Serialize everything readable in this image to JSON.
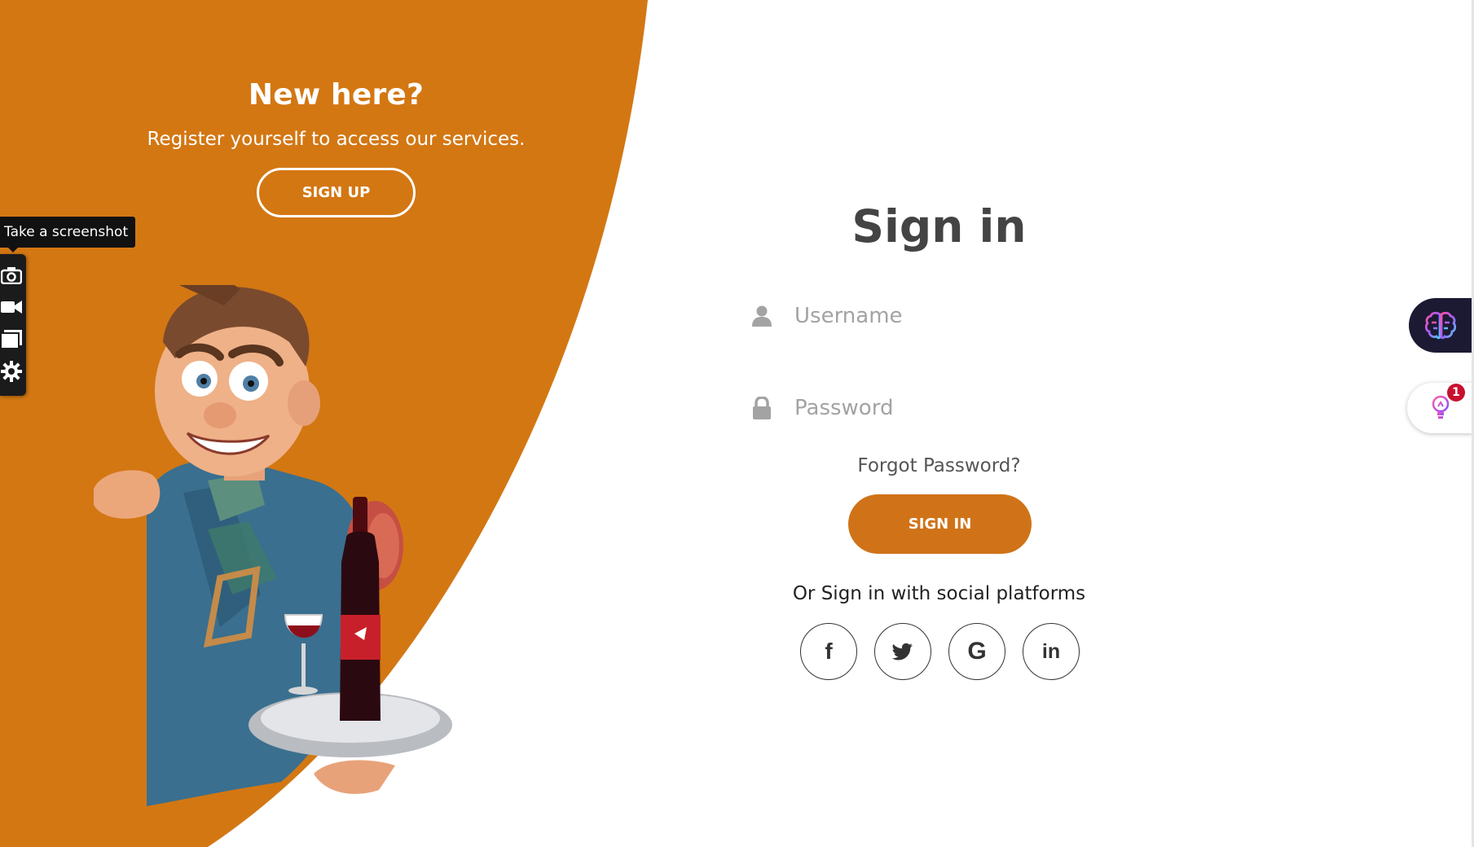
{
  "colors": {
    "accent": "#d07318",
    "panel": "#d37713",
    "text_dark": "#444444"
  },
  "left_panel": {
    "title": "New here?",
    "subtitle": "Register yourself to access our services.",
    "signup_label": "SIGN UP"
  },
  "screenshot_tool": {
    "tooltip": "Take a screenshot",
    "tools": [
      "camera-icon",
      "video-icon",
      "window-icon",
      "gear-icon"
    ]
  },
  "signin": {
    "title": "Sign in",
    "username_placeholder": "Username",
    "password_placeholder": "Password",
    "forgot_label": "Forgot Password?",
    "submit_label": "SIGN IN",
    "social_text": "Or Sign in with social platforms",
    "social": [
      {
        "name": "facebook",
        "glyph": "f"
      },
      {
        "name": "twitter",
        "glyph": "twitter-icon"
      },
      {
        "name": "google",
        "glyph": "G"
      },
      {
        "name": "linkedin",
        "glyph": "in"
      }
    ]
  },
  "widgets": {
    "brain_icon": "brain-icon",
    "bulb_icon": "lightbulb-icon",
    "badge_count": "1"
  }
}
